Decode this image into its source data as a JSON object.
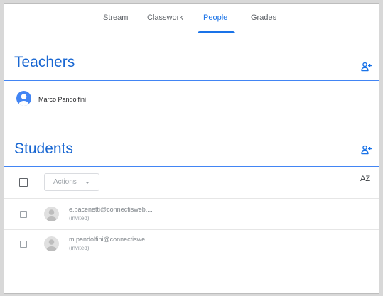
{
  "nav": {
    "tabs": [
      {
        "label": "Stream",
        "active": false
      },
      {
        "label": "Classwork",
        "active": false
      },
      {
        "label": "People",
        "active": true
      },
      {
        "label": "Grades",
        "active": false
      }
    ]
  },
  "teachers": {
    "title": "Teachers",
    "add_icon": "add-person-icon",
    "list": [
      {
        "name": "Marco Pandolfini",
        "avatar": "person-avatar-icon"
      }
    ]
  },
  "students": {
    "title": "Students",
    "add_icon": "add-person-icon",
    "actions_label": "Actions",
    "sort_label": "AZ",
    "list": [
      {
        "email": "e.bacenetti@connectisweb....",
        "status": "(invited)"
      },
      {
        "email": "m.pandolfini@connectiswe...",
        "status": "(invited)"
      }
    ]
  },
  "colors": {
    "accent": "#1a73e8",
    "section_title": "#1967d2",
    "section_rule": "#4285f4",
    "teacher_avatar": "#4285f4",
    "student_avatar": "#bdbdbd"
  }
}
